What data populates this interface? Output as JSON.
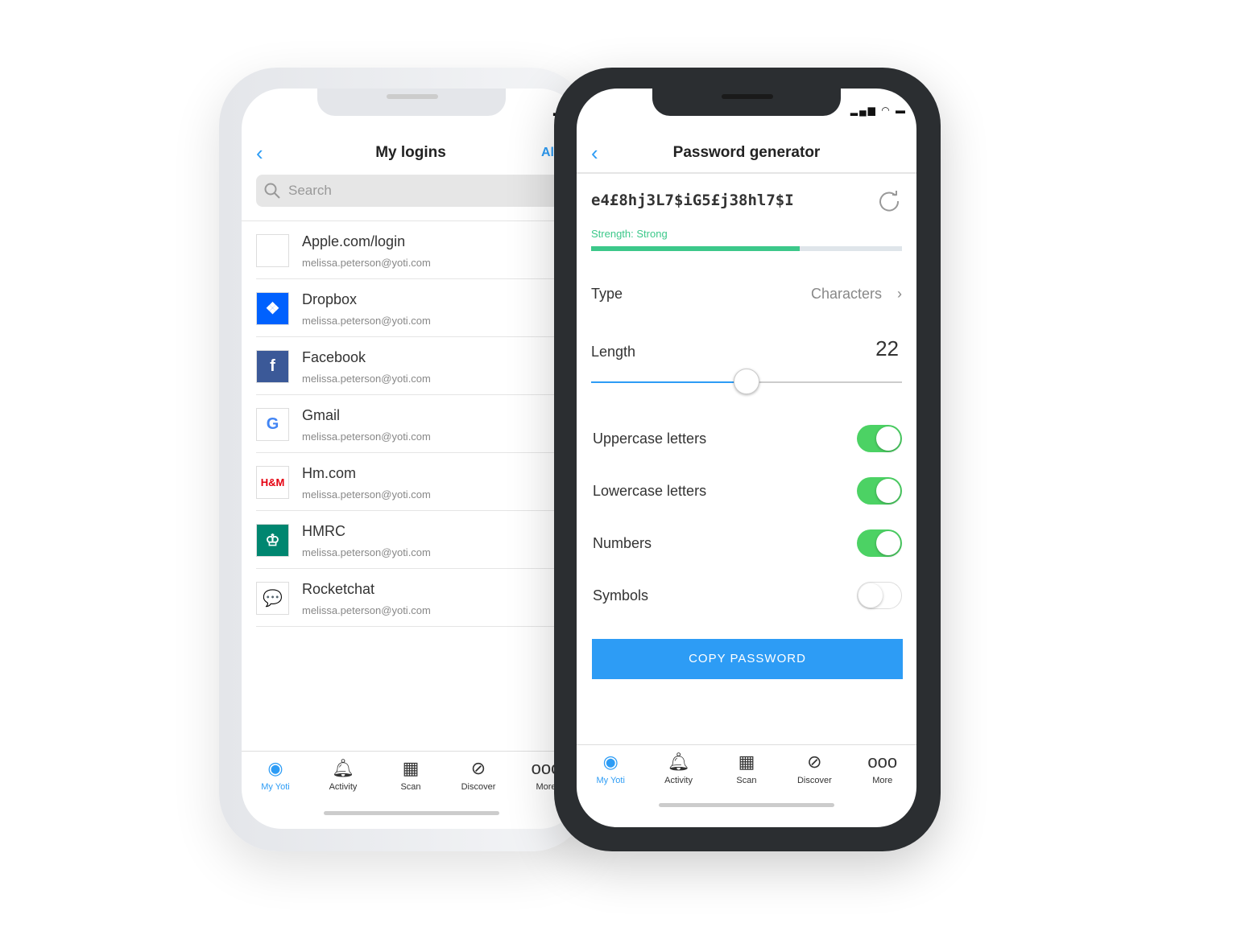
{
  "status": {
    "signal": "▂▄▆",
    "wifi": "wifi",
    "battery": "battery"
  },
  "logins": {
    "title": "My logins",
    "right_action": "All",
    "search_placeholder": "Search",
    "items": [
      {
        "name": "Apple.com/login",
        "email": "melissa.peterson@yoti.com",
        "logo": "apple-logo",
        "color": "#555"
      },
      {
        "name": "Dropbox",
        "email": "melissa.peterson@yoti.com",
        "logo": "dropbox-logo",
        "color": "#0061fe"
      },
      {
        "name": "Facebook",
        "email": "melissa.peterson@yoti.com",
        "logo": "facebook-logo",
        "color": "#3b5998"
      },
      {
        "name": "Gmail",
        "email": "melissa.peterson@yoti.com",
        "logo": "google-logo",
        "color": "#4285f4"
      },
      {
        "name": "Hm.com",
        "email": "melissa.peterson@yoti.com",
        "logo": "hm-logo",
        "color": "#e50010"
      },
      {
        "name": "HMRC",
        "email": "melissa.peterson@yoti.com",
        "logo": "hmrc-logo",
        "color": "#008670"
      },
      {
        "name": "Rocketchat",
        "email": "melissa.peterson@yoti.com",
        "logo": "rocketchat-logo",
        "color": "#db2323"
      }
    ]
  },
  "generator": {
    "title": "Password generator",
    "password": "e4£8hj3L7$iG5£j38hl7$I",
    "strength_label": "Strength: Strong",
    "strength_fraction": 0.67,
    "type_label": "Type",
    "type_value": "Characters",
    "length_label": "Length",
    "length_value": "22",
    "length_fraction": 0.5,
    "options": [
      {
        "label": "Uppercase letters",
        "on": true
      },
      {
        "label": "Lowercase letters",
        "on": true
      },
      {
        "label": "Numbers",
        "on": true
      },
      {
        "label": "Symbols",
        "on": false
      }
    ],
    "copy_button": "COPY PASSWORD"
  },
  "tabs": [
    {
      "label": "My Yoti",
      "icon": "my-yoti-icon"
    },
    {
      "label": "Activity",
      "icon": "bell-icon"
    },
    {
      "label": "Scan",
      "icon": "qr-icon"
    },
    {
      "label": "Discover",
      "icon": "compass-icon"
    },
    {
      "label": "More",
      "icon": "more-icon"
    }
  ],
  "colors": {
    "accent": "#2d9cf5",
    "strength": "#3cc88a",
    "toggle_on": "#4cd264"
  }
}
